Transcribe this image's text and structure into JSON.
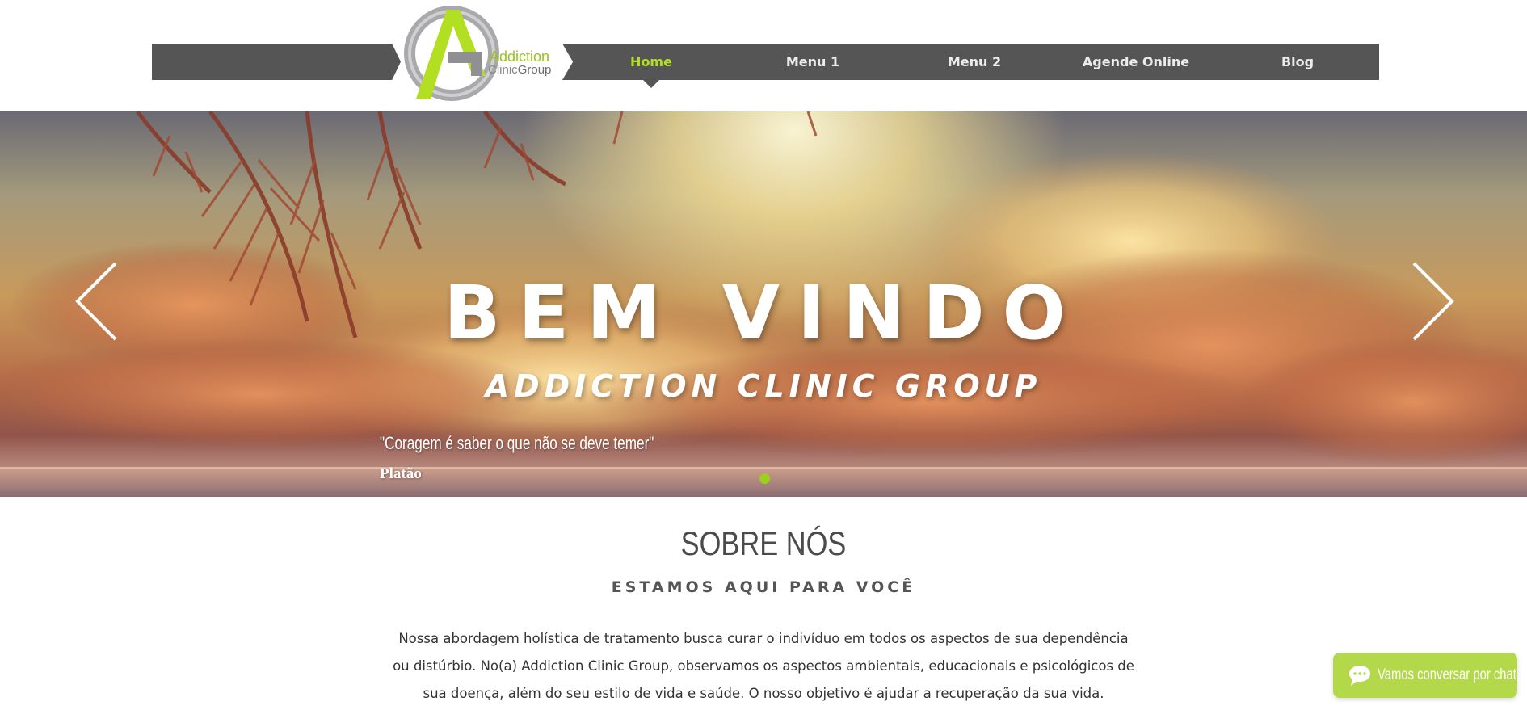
{
  "header": {
    "logo": {
      "line1": "Addiction",
      "line2_a": "Clinic",
      "line2_b": "Group"
    },
    "nav": [
      {
        "label": "Home",
        "active": true
      },
      {
        "label": "Menu 1",
        "active": false
      },
      {
        "label": "Menu 2",
        "active": false
      },
      {
        "label": "Agende Online",
        "active": false
      },
      {
        "label": "Blog",
        "active": false
      }
    ]
  },
  "hero": {
    "title": "BEM VINDO",
    "subtitle": "ADDICTION CLINIC GROUP",
    "quote": "\"Coragem é saber o que não se deve temer\"",
    "author": "Platão",
    "prev_icon": "chevron-left-icon",
    "next_icon": "chevron-right-icon",
    "active_dot_color": "#9bd11c"
  },
  "about": {
    "heading": "SOBRE NÓS",
    "subheading": "ESTAMOS AQUI PARA VOCÊ",
    "body": "Nossa abordagem holística de tratamento busca curar o indivíduo em todos os aspectos de sua dependência ou distúrbio. No(a) Addiction Clinic Group, observamos os aspectos ambientais, educacionais e psicológicos de sua doença, além do seu estilo de vida e saúde. O nosso objetivo é ajudar a recuperação da sua vida."
  },
  "chat": {
    "label": "Vamos conversar por chat",
    "icon": "chat-bubble-icon",
    "color": "#b3d84a"
  },
  "colors": {
    "accent": "#b3df22",
    "nav_bg": "#555555"
  }
}
